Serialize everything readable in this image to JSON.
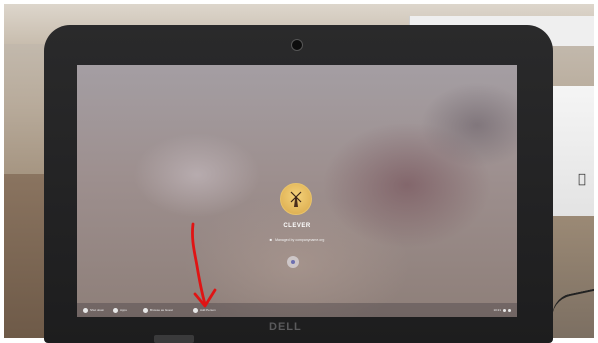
{
  "photo": {
    "laptop_brand": "DELL",
    "screen": {
      "user_name": "CLEVER",
      "managed_by": "Managed by companyname.org",
      "shelf_items": [
        {
          "label": "Shut down",
          "icon": "power-icon"
        },
        {
          "label": "Apps",
          "icon": "apps-icon"
        },
        {
          "label": "Browse as Guest",
          "icon": "guest-icon"
        },
        {
          "label": "Add Person",
          "icon": "add-person-icon"
        }
      ],
      "status_time": "10:21"
    },
    "annotation_color": "#e01414"
  }
}
